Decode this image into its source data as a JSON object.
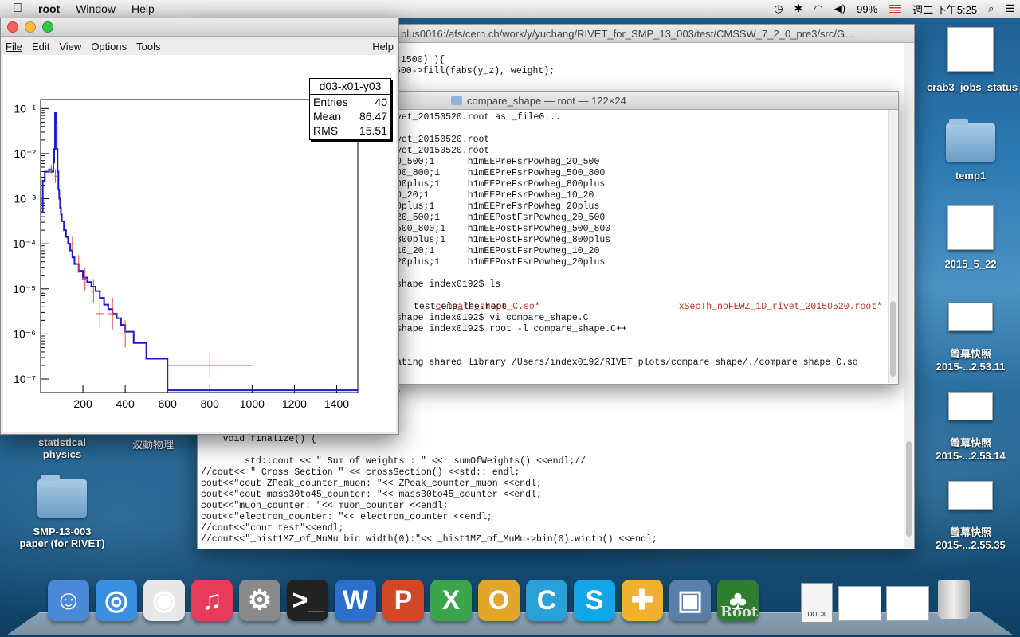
{
  "menubar": {
    "apple_icon": "apple-logo",
    "app_name": "root",
    "items": [
      "Window",
      "Help"
    ],
    "battery": "99%",
    "clock": "週二 下午5:25"
  },
  "terminal_back": {
    "title": "plus0016:/afs/cern.ch/work/y/yuchang/RIVET_for_SMP_13_003/test/CMSSW_7_2_0_pre3/src/G...",
    "lines_top": [
      "<1500) ){",
      "500->fill(fabs(y_z), weight);"
    ],
    "lines_bottom": [
      "    void finalize() {",
      "",
      "        std::cout << \" Sum of weights : \" <<  sumOfWeights() <<endl;//",
      "//cout<< \" Cross Section \" << crossSection() <<std:: endl;",
      "cout<<\"cout ZPeak_counter_muon: \"<< ZPeak_counter_muon <<endl;",
      "cout<<\"cout mass30to45_counter: \"<< mass30to45_counter <<endl;",
      "cout<<\"muon_counter: \"<< muon_counter <<endl;",
      "cout<<\"electron_counter: \"<< electron_counter <<endl;",
      "//cout<<\"cout test\"<<endl;",
      "//cout<<\"_hist1MZ_of_MuMu bin width(0):\"<< _hist1MZ_of_MuMu->bin(0).width() <<endl;"
    ],
    "brace": "{"
  },
  "terminal_front": {
    "title": "compare_shape — root — 122×24",
    "lines": [
      "vet_20150520.root as _file0...",
      "",
      "vet_20150520.root",
      "vet_20150520.root",
      "0_500;1      h1mEEPreFsrPowheg_20_500",
      "00_800;1     h1mEEPreFsrPowheg_500_800",
      "00plus;1     h1mEEPreFsrPowheg_800plus",
      "0_20;1       h1mEEPreFsrPowheg_10_20",
      "0plus;1      h1mEEPreFsrPowheg_20plus",
      "20_500;1     h1mEEPostFsrPowheg_20_500",
      "500_800;1    h1mEEPostFsrPowheg_500_800",
      "800plus;1    h1mEEPostFsrPowheg_800plus",
      "10_20;1      h1mEEPostFsrPowheg_10_20",
      "20plus;1     h1mEEPostFsrPowheg_20plus",
      "",
      "shape index0192$ ls"
    ],
    "ls_so": "compare_shape_C.so*",
    "ls_root": "xSecTh_noFEWZ_1D_rivet_20150520.root*",
    "ls_test": "test_ele_lhe.root",
    "line_vi": "shape index0192$ vi compare_shape.C",
    "line_root": "shape index0192$ root -l compare_shape.C++",
    "line_lib": "ating shared library /Users/index0192/RIVET_plots/compare_shape/./compare_shape_C.so"
  },
  "root_window": {
    "menu": [
      "File",
      "Edit",
      "View",
      "Options",
      "Tools"
    ],
    "help": "Help",
    "stats": {
      "name": "d03-x01-y03",
      "entries_label": "Entries",
      "entries": "40",
      "mean_label": "Mean",
      "mean": "86.47",
      "rms_label": "RMS",
      "rms": "15.51"
    }
  },
  "chart_data": {
    "type": "line",
    "title": "",
    "xlabel": "",
    "ylabel": "",
    "log_y": true,
    "ylim_exp": [
      -7.3,
      -0.8
    ],
    "xlim": [
      0,
      1500
    ],
    "x_ticks": [
      "200",
      "400",
      "600",
      "800",
      "1000",
      "1200",
      "1400"
    ],
    "y_ticks": [
      "10⁻¹",
      "10⁻²",
      "10⁻³",
      "10⁻⁴",
      "10⁻⁵",
      "10⁻⁶",
      "10⁻⁷"
    ],
    "series": [
      {
        "color": "#1a18c8",
        "style": "step",
        "x": [
          0,
          10,
          20,
          30,
          40,
          50,
          60,
          64,
          68,
          72,
          76,
          80,
          84,
          88,
          92,
          96,
          100,
          110,
          120,
          130,
          140,
          150,
          160,
          180,
          200,
          220,
          240,
          260,
          280,
          300,
          320,
          340,
          360,
          380,
          400,
          440,
          500,
          600,
          1000,
          1500
        ],
        "log10y": [
          -3.3,
          -2.6,
          -2.4,
          -2.4,
          -2.35,
          -2.4,
          -2.2,
          -1.9,
          -1.1,
          -1.3,
          -1.9,
          -2.4,
          -2.8,
          -3.0,
          -3.2,
          -3.35,
          -3.5,
          -3.7,
          -3.85,
          -4.0,
          -4.15,
          -4.3,
          -4.45,
          -4.6,
          -4.75,
          -4.85,
          -4.95,
          -5.05,
          -5.2,
          -5.35,
          -5.45,
          -5.55,
          -5.65,
          -5.8,
          -5.95,
          -6.2,
          -6.55,
          -7.25,
          -7.25,
          -7.25
        ]
      },
      {
        "color": "#e04848",
        "style": "errorbars",
        "points": [
          {
            "x": 50,
            "log10y": -2.35,
            "xerr": 5,
            "yerr": 0.1
          },
          {
            "x": 70,
            "log10y": -2.5,
            "xerr": 5,
            "yerr": 0.15
          },
          {
            "x": 150,
            "log10y": -4.0,
            "xerr": 10,
            "yerr": 0.15
          },
          {
            "x": 180,
            "log10y": -4.45,
            "xerr": 15,
            "yerr": 0.2
          },
          {
            "x": 210,
            "log10y": -4.8,
            "xerr": 15,
            "yerr": 0.25
          },
          {
            "x": 250,
            "log10y": -5.05,
            "xerr": 20,
            "yerr": 0.25
          },
          {
            "x": 280,
            "log10y": -5.55,
            "xerr": 20,
            "yerr": 0.3
          },
          {
            "x": 340,
            "log10y": -5.55,
            "xerr": 25,
            "yerr": 0.35
          },
          {
            "x": 400,
            "log10y": -6.0,
            "xerr": 40,
            "yerr": 0.3
          },
          {
            "x": 800,
            "log10y": -6.7,
            "xerr": 200,
            "yerr": 0.25
          }
        ]
      }
    ]
  },
  "desktop": {
    "icons": [
      {
        "label": "crab3_jobs_status",
        "kind": "doc"
      },
      {
        "label": "temp1",
        "kind": "folder"
      },
      {
        "label": "2015_5_22",
        "kind": "doc"
      },
      {
        "label": "螢幕快照 2015-...2.53.11",
        "kind": "shot"
      },
      {
        "label": "螢幕快照 2015-...2.53.14",
        "kind": "shot"
      },
      {
        "label": "螢幕快照 2015-...2.55.35",
        "kind": "shot"
      }
    ],
    "left_labels": {
      "statistical": "statistical physics",
      "wave": "波動物理",
      "smp": "SMP-13-003 paper (for RIVET)"
    }
  },
  "dock": {
    "apps": [
      {
        "name": "Finder",
        "color": "#4a88d8",
        "glyph": "☺"
      },
      {
        "name": "Safari",
        "color": "#3a8fe0",
        "glyph": "◎"
      },
      {
        "name": "Chrome",
        "color": "#e8e8e8",
        "glyph": "◉"
      },
      {
        "name": "iTunes",
        "color": "#e83a5a",
        "glyph": "♫"
      },
      {
        "name": "System Preferences",
        "color": "#8a8a8a",
        "glyph": "⚙"
      },
      {
        "name": "Terminal",
        "color": "#222222",
        "glyph": ">_"
      },
      {
        "name": "Word",
        "color": "#2b6ecc",
        "glyph": "W"
      },
      {
        "name": "PowerPoint",
        "color": "#d24726",
        "glyph": "P"
      },
      {
        "name": "Excel",
        "color": "#3aa54a",
        "glyph": "X"
      },
      {
        "name": "Outlook",
        "color": "#e3a62d",
        "glyph": "O"
      },
      {
        "name": "C app",
        "color": "#2aa0d8",
        "glyph": "C"
      },
      {
        "name": "Skype",
        "color": "#12a5e8",
        "glyph": "S"
      },
      {
        "name": "Maps",
        "color": "#f0b030",
        "glyph": "✚"
      },
      {
        "name": "iPhoto",
        "color": "#5a7fa8",
        "glyph": "▣"
      },
      {
        "name": "Root",
        "color": "#2f7d2f",
        "glyph": "♣"
      }
    ],
    "root_label": "Root",
    "docx_label": "DOCX"
  }
}
